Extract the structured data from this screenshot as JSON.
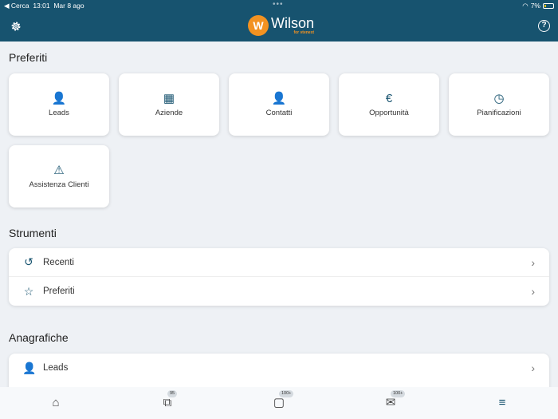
{
  "status": {
    "back": "◀ Cerca",
    "time": "13:01",
    "date": "Mar 8 ago",
    "battery": "7%"
  },
  "header": {
    "logo_name": "Wilson",
    "logo_sub": "for vtenext",
    "logo_mark": "W"
  },
  "sections": {
    "favorites": "Preferiti",
    "tools": "Strumenti",
    "registry": "Anagrafiche"
  },
  "favorites": [
    {
      "label": "Leads",
      "icon": "person-outline-icon",
      "glyph": "👤"
    },
    {
      "label": "Aziende",
      "icon": "building-icon",
      "glyph": "▦"
    },
    {
      "label": "Contatti",
      "icon": "person-icon",
      "glyph": "👤"
    },
    {
      "label": "Opportunità",
      "icon": "euro-icon",
      "glyph": "€"
    },
    {
      "label": "Pianificazioni",
      "icon": "clock-icon",
      "glyph": "◷"
    },
    {
      "label": "Assistenza Clienti",
      "icon": "warning-icon",
      "glyph": "⚠"
    }
  ],
  "tools": [
    {
      "label": "Recenti",
      "glyph": "↺"
    },
    {
      "label": "Preferiti",
      "glyph": "☆"
    }
  ],
  "registry": [
    {
      "label": "Leads",
      "glyph": "👤"
    }
  ],
  "bottom": {
    "processes_badge": "95",
    "chat_badge": "100+",
    "mail_badge": "100+"
  },
  "colors": {
    "header": "#17536f",
    "accent": "#f29221"
  }
}
